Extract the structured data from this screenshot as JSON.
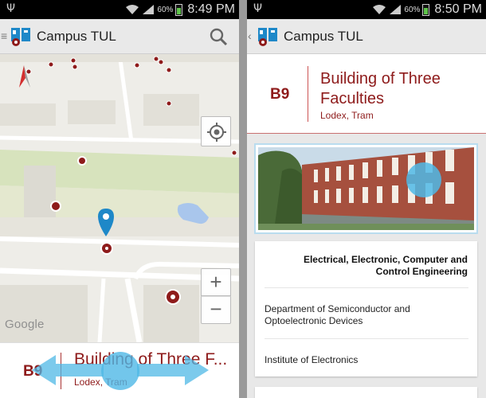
{
  "left": {
    "status": {
      "battery_pct": "60%",
      "time": "8:49 PM"
    },
    "app_title": "Campus TUL",
    "map_attribution": "Google",
    "zoom_in_label": "+",
    "zoom_out_label": "−",
    "panel": {
      "code": "B9",
      "title": "Building of Three F...",
      "subtitle": "Lodex, Tram"
    }
  },
  "right": {
    "status": {
      "battery_pct": "60%",
      "time": "8:50 PM"
    },
    "app_title": "Campus TUL",
    "detail": {
      "code": "B9",
      "title": "Building of Three Faculties",
      "subtitle": "Lodex, Tram",
      "faculty": "Electrical, Electronic, Computer and Control Engineering",
      "departments": [
        "Department of Semiconductor and Optoelectronic Devices",
        "Institute of Electronics"
      ]
    }
  },
  "colors": {
    "brand_red": "#8e1b1b",
    "marker_blue": "#1e88c8",
    "map_green": "#dfe8c8",
    "touch_overlay": "#4fb8e6"
  },
  "icons": [
    "usb-icon",
    "wifi-icon",
    "signal-icon",
    "battery-icon",
    "menu-icon",
    "app-logo-icon",
    "search-icon",
    "compass-icon",
    "my-location-icon",
    "map-marker-icon",
    "back-icon",
    "swipe-left-arrow-icon",
    "swipe-right-arrow-icon"
  ]
}
